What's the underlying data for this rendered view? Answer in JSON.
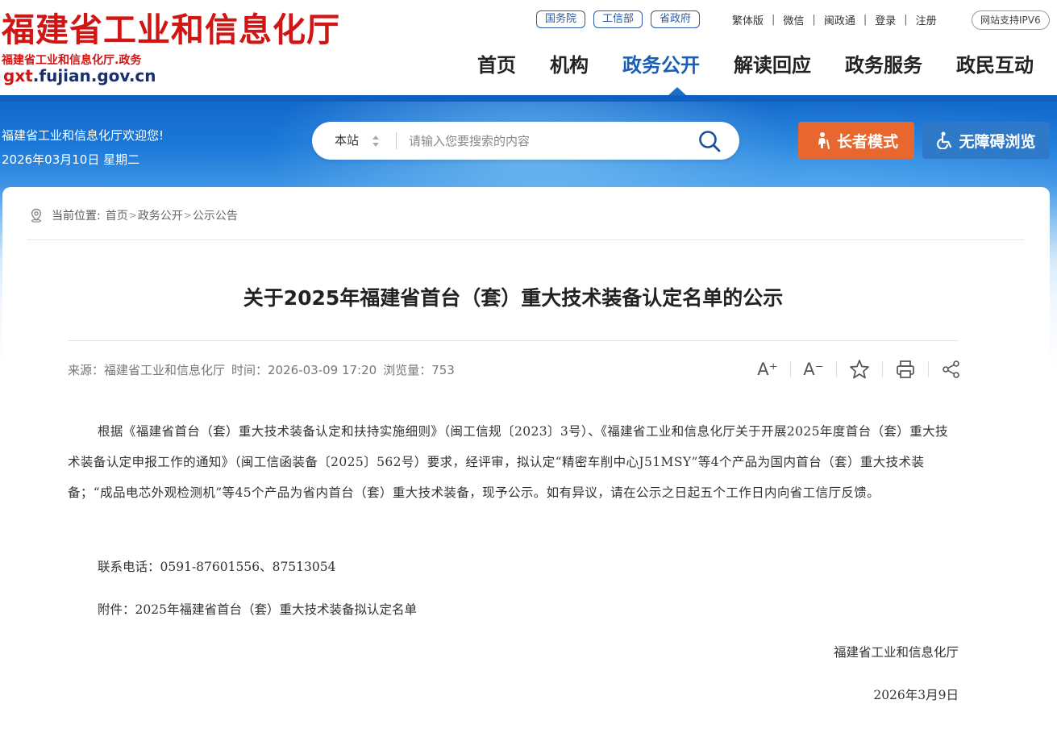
{
  "header": {
    "logo_title": "福建省工业和信息化厅",
    "logo_sub": "福建省工业和信息化厅.政务",
    "logo_domain_prefix": "gxt",
    "logo_domain_rest": ".fujian.gov.cn",
    "gov_links": [
      "国务院",
      "工信部",
      "省政府"
    ],
    "top_links": [
      "繁体版",
      "微信",
      "闽政通",
      "登录",
      "注册"
    ],
    "ipv6": "网站支持IPV6",
    "nav": [
      "首页",
      "机构",
      "政务公开",
      "解读回应",
      "政务服务",
      "政民互动"
    ],
    "nav_active_index": 2
  },
  "banner": {
    "welcome": "福建省工业和信息化厅欢迎您!",
    "date": "2026年03月10日 星期二",
    "search_scope": "本站",
    "search_placeholder": "请输入您要搜索的内容",
    "elder_mode": "长者模式",
    "accessible": "无障碍浏览"
  },
  "breadcrumb": {
    "label": "当前位置:",
    "items": [
      "首页",
      "政务公开",
      "公示公告"
    ]
  },
  "article": {
    "title": "关于2025年福建省首台（套）重大技术装备认定名单的公示",
    "source": "来源：福建省工业和信息化厅",
    "time": "时间：2026-03-09 17:20",
    "views": "浏览量：753",
    "tools": {
      "font_increase": "A⁺",
      "font_decrease": "A⁻"
    },
    "body": "根据《福建省首台（套）重大技术装备认定和扶持实施细则》（闽工信规〔2023〕3号）、《福建省工业和信息化厅关于开展2025年度首台（套）重大技术装备认定申报工作的通知》（闽工信函装备〔2025〕562号）要求，经评审，拟认定“精密车削中心J51MSY”等4个产品为国内首台（套）重大技术装备；“成品电芯外观检测机”等45个产品为省内首台（套）重大技术装备，现予公示。如有异议，请在公示之日起五个工作日内向省工信厅反馈。",
    "contact": "联系电话：0591-87601556、87513054",
    "attachment": "附件：2025年福建省首台（套）重大技术装备拟认定名单",
    "signer": "福建省工业和信息化厅",
    "sign_date": "2026年3月9日"
  },
  "colors": {
    "brand_red": "#d01515",
    "nav_active": "#1a5fb4",
    "elder_orange": "#e8672e",
    "access_blue": "#2f79c9"
  }
}
